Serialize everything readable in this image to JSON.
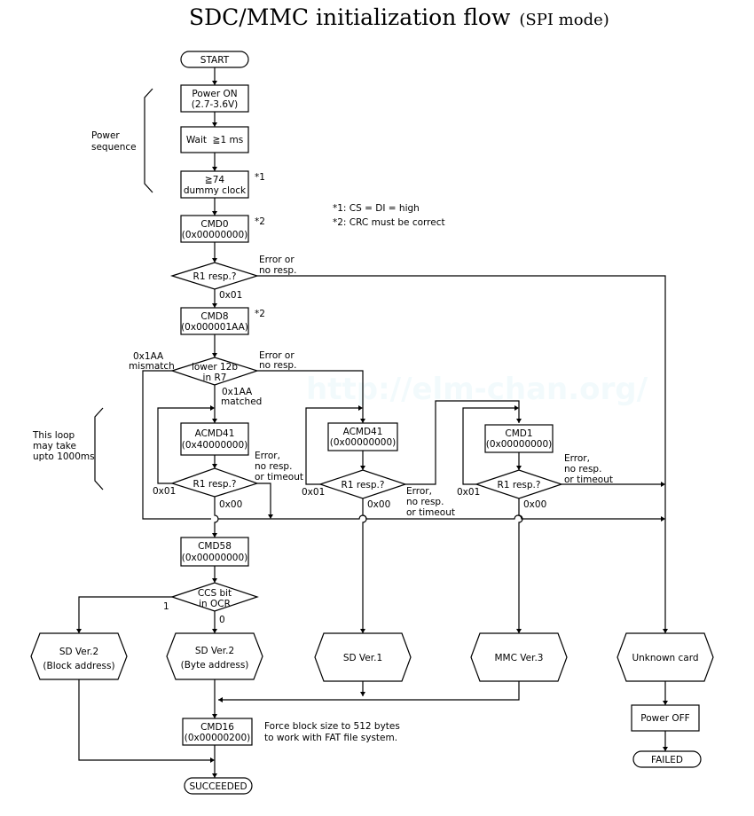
{
  "title": {
    "main": "SDC/MMC initialization flow",
    "sub": "(SPI mode)"
  },
  "watermark": "http://elm-chan.org/",
  "notes": {
    "n1": "*1: CS = DI = high",
    "n2": "*2: CRC must be correct",
    "mark1": "*1",
    "mark2": "*2",
    "power_sequence": [
      "Power",
      "sequence"
    ],
    "loop_time": [
      "This loop",
      "may take",
      "upto 1000ms"
    ],
    "force_block": [
      "Force block size to 512 bytes",
      "to work with FAT file system."
    ]
  },
  "nodes": {
    "start": "START",
    "power_on": [
      "Power ON",
      "(2.7-3.6V)"
    ],
    "wait": "Wait  ≧1 ms",
    "dummy_clock": [
      "≧74",
      "dummy clock"
    ],
    "cmd0": [
      "CMD0",
      "(0x00000000)"
    ],
    "r1_cmd0": "R1 resp.?",
    "cmd8": [
      "CMD8",
      "(0x000001AA)"
    ],
    "r7_check": [
      "lower 12b",
      "in R7"
    ],
    "acmd41_hcs": [
      "ACMD41",
      "(0x40000000)"
    ],
    "r1_acmd41_hcs": "R1 resp.?",
    "acmd41": [
      "ACMD41",
      "(0x00000000)"
    ],
    "r1_acmd41": "R1 resp.?",
    "cmd1": [
      "CMD1",
      "(0x00000000)"
    ],
    "r1_cmd1": "R1 resp.?",
    "cmd58": [
      "CMD58",
      "(0x00000000)"
    ],
    "ccs_check": [
      "CCS bit",
      "in OCR"
    ],
    "sd2_block": [
      "SD Ver.2",
      "(Block address)"
    ],
    "sd2_byte": [
      "SD Ver.2",
      "(Byte address)"
    ],
    "sd1": "SD Ver.1",
    "mmc3": "MMC Ver.3",
    "unknown": "Unknown card",
    "power_off": "Power OFF",
    "failed": "FAILED",
    "cmd16": [
      "CMD16",
      "(0x00000200)"
    ],
    "succeeded": "SUCCEEDED"
  },
  "edge_labels": {
    "error_no_resp": [
      "Error or",
      "no resp."
    ],
    "r1_0x01": "0x01",
    "mismatch": [
      "0x1AA",
      "mismatch"
    ],
    "error_no_resp_r7": [
      "Error or",
      "no resp."
    ],
    "matched": [
      "0x1AA",
      "matched"
    ],
    "loop_0x01_a": "0x01",
    "ok_0x00_a": "0x00",
    "err_a": [
      "Error,",
      "no resp.",
      "or timeout"
    ],
    "loop_0x01_b": "0x01",
    "ok_0x00_b": "0x00",
    "err_b": [
      "Error,",
      "no resp.",
      "or timeout"
    ],
    "loop_0x01_c": "0x01",
    "ok_0x00_c": "0x00",
    "err_c": [
      "Error,",
      "no resp.",
      "or timeout"
    ],
    "ccs_1": "1",
    "ccs_0": "0"
  }
}
